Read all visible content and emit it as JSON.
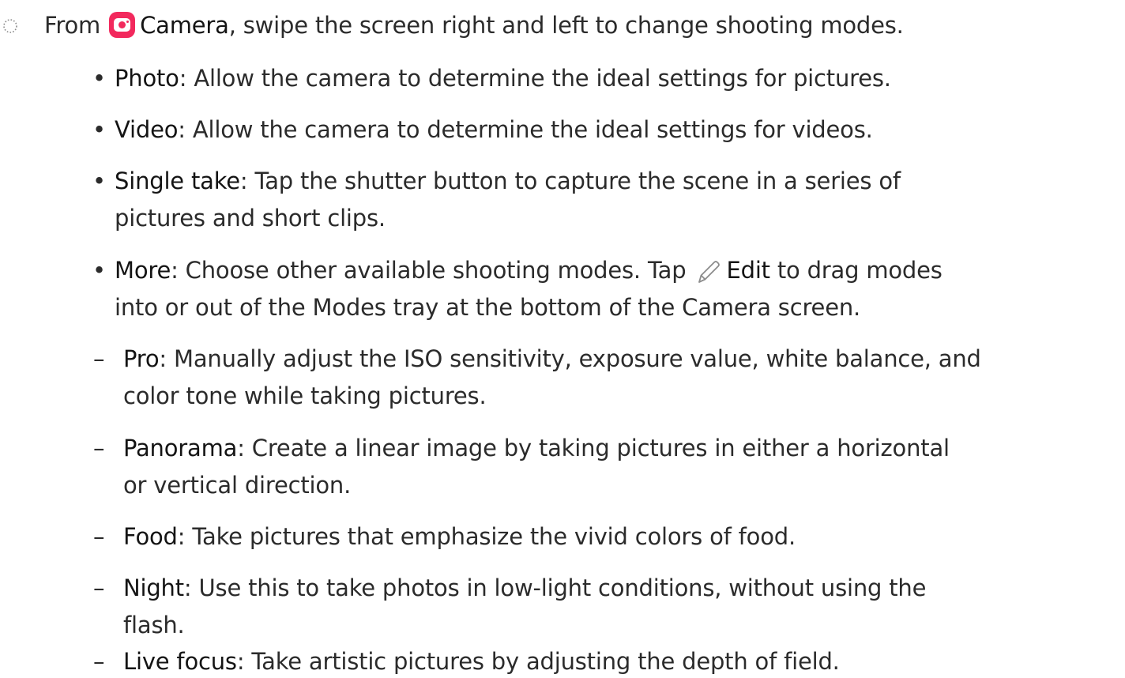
{
  "step": {
    "prefix": "From",
    "app_name": "Camera",
    "text": ", swipe the screen right and left to change shooting modes."
  },
  "bullets": [
    {
      "term": "Photo",
      "desc": ": Allow the camera to determine the ideal settings for pictures."
    },
    {
      "term": "Video",
      "desc": ": Allow the camera to determine the ideal settings for videos."
    },
    {
      "term": "Single take",
      "desc": ": Tap the shutter button to capture the scene in a series of",
      "desc2": "pictures and short clips."
    },
    {
      "term": "More",
      "desc_a": ": Choose other available shooting modes. Tap",
      "edit_label": "Edit",
      "desc_b": " to drag modes",
      "desc2": "into or out of the Modes tray at the bottom of the Camera screen."
    }
  ],
  "sub_bullets": [
    {
      "term": "Pro",
      "desc": ": Manually adjust the ISO sensitivity, exposure value, white balance, and",
      "desc2": "color tone while taking pictures."
    },
    {
      "term": "Panorama",
      "desc": ": Create a linear image by taking pictures in either a horizontal",
      "desc2": "or vertical direction."
    },
    {
      "term": "Food",
      "desc": ": Take pictures that emphasize the vivid colors of food."
    },
    {
      "term": "Night",
      "desc": ": Use this to take photos in low-light conditions, without using the",
      "desc2": "flash."
    },
    {
      "term": "Live focus",
      "desc": ": Take artistic pictures by adjusting the depth of field."
    }
  ],
  "symbols": {
    "bullet": "•",
    "dash": "–"
  },
  "icons": {
    "step_marker": "dotted-circle-icon",
    "camera": "camera-app-icon",
    "edit": "pencil-icon"
  },
  "colors": {
    "camera_icon_bg": "#f2295d",
    "text": "#2b2b2b"
  }
}
